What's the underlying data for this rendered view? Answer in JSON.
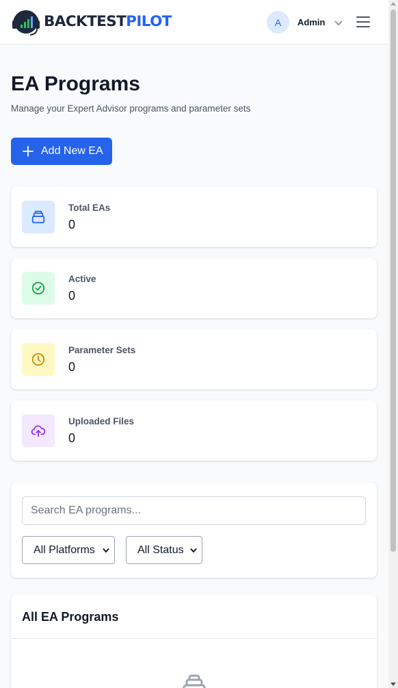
{
  "header": {
    "brand": {
      "part1": "BACKTEST",
      "part2": "PILOT"
    },
    "user": {
      "initial": "A",
      "name": "Admin"
    },
    "icons": {
      "user_menu": "chevron-down-icon",
      "main_menu": "hamburger-menu-icon"
    }
  },
  "page": {
    "title": "EA Programs",
    "subtitle": "Manage your Expert Advisor programs and parameter sets",
    "add_button_label": "Add New EA"
  },
  "stats": [
    {
      "label": "Total EAs",
      "value": "0",
      "icon": "stack-icon",
      "color": "#2563eb",
      "bg": "#dbeafe"
    },
    {
      "label": "Active",
      "value": "0",
      "icon": "check-circle-icon",
      "color": "#16a34a",
      "bg": "#dcfce7"
    },
    {
      "label": "Parameter Sets",
      "value": "0",
      "icon": "clock-icon",
      "color": "#ca8a04",
      "bg": "#fef9c3"
    },
    {
      "label": "Uploaded Files",
      "value": "0",
      "icon": "cloud-upload-icon",
      "color": "#9333ea",
      "bg": "#f3e8ff"
    }
  ],
  "filters": {
    "search_placeholder": "Search EA programs...",
    "platform_selected": "All Platforms",
    "status_selected": "All Status"
  },
  "list": {
    "title": "All EA Programs"
  },
  "colors": {
    "primary": "#2563eb",
    "brand_dark": "#1e293b",
    "page_bg": "#f9fafb"
  }
}
